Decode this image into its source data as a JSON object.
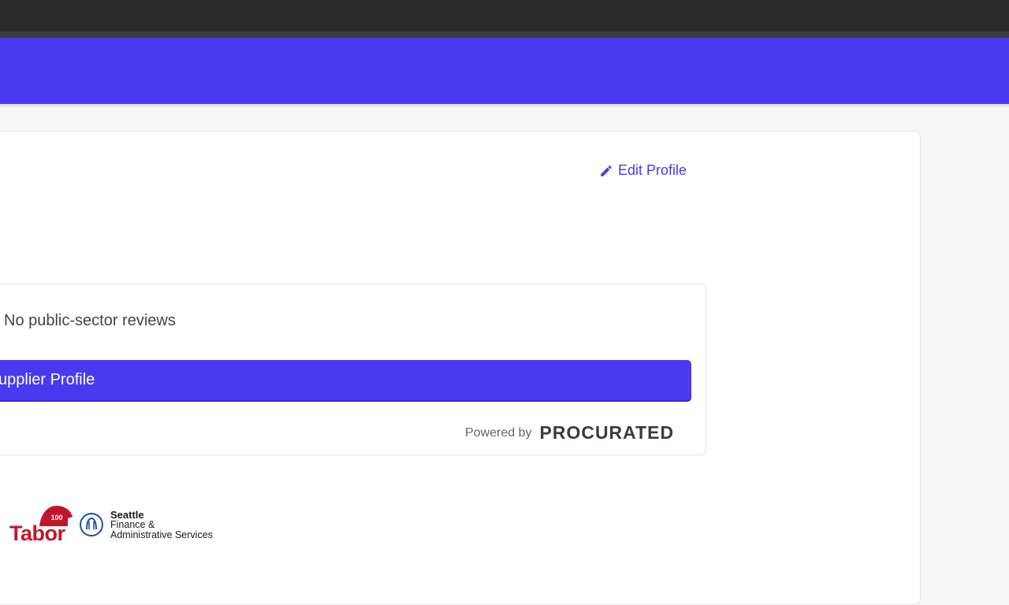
{
  "header": {
    "brand_color": "#4a3aef",
    "chrome_color": "#2a2a2a"
  },
  "profile": {
    "edit_label": "Edit Profile",
    "edit_icon": "pencil-icon"
  },
  "reviews": {
    "summary": "No public-sector reviews",
    "button_label": "upplier Profile"
  },
  "powered_by": {
    "label": "Powered by",
    "logo_text": "PROCURATED"
  },
  "footer": {
    "tabor_logo": "Tabor",
    "tabor_badge": "100",
    "seattle_line1": "Seattle",
    "seattle_line2": "Finance &",
    "seattle_line3": "Administrative Services"
  }
}
